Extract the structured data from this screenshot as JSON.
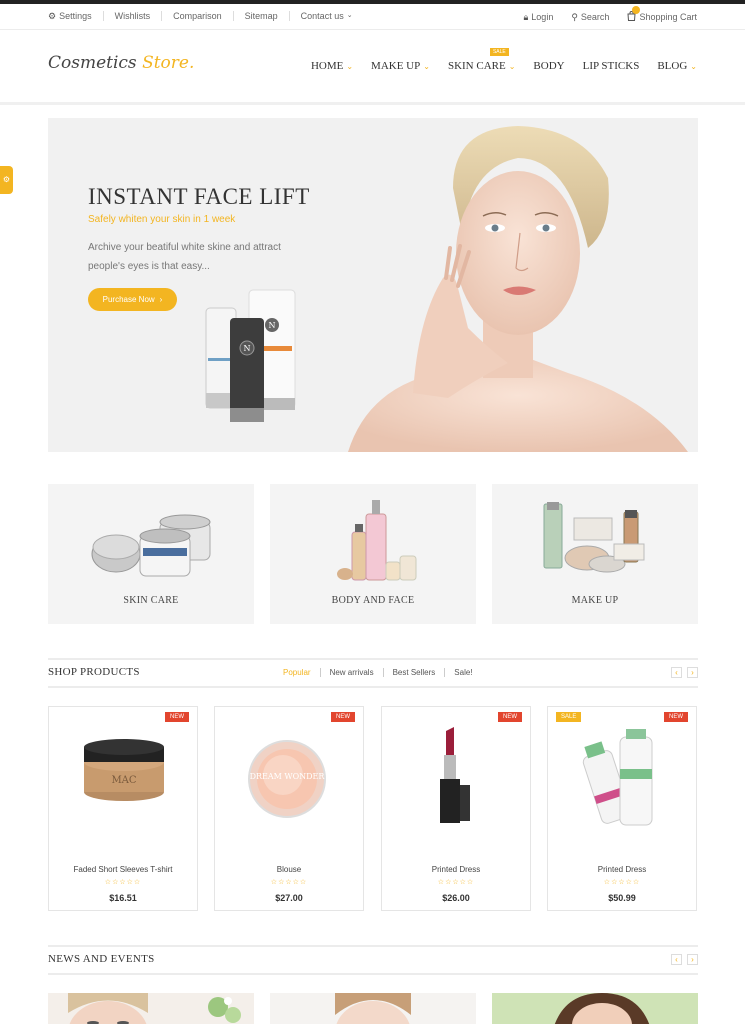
{
  "topbar": {
    "left": [
      "Settings",
      "Wishlists",
      "Comparison",
      "Sitemap",
      "Contact us"
    ],
    "login": "Login",
    "search": "Search",
    "cart": "Shopping Cart"
  },
  "logo": {
    "part1": "Cosmetics",
    "part2": "Store."
  },
  "nav": {
    "items": [
      "HOME",
      "MAKE UP",
      "SKIN CARE",
      "BODY",
      "LIP STICKS",
      "BLOG"
    ],
    "sale_badge": "SALE"
  },
  "hero": {
    "title": "INSTANT FACE LIFT",
    "subtitle": "Safely whiten your skin in 1 week",
    "description": "Archive your beatiful white skine and attract people's eyes is that easy...",
    "button": "Purchase Now"
  },
  "categories": [
    "SKIN CARE",
    "BODY AND FACE",
    "MAKE UP"
  ],
  "shop": {
    "title": "SHOP PRODUCTS",
    "tabs": [
      "Popular",
      "New arrivals",
      "Best Sellers",
      "Sale!"
    ],
    "products": [
      {
        "name": "Faded Short Sleeves T-shirt",
        "price": "$16.51",
        "badge": "NEW",
        "stars": "☆☆☆☆☆"
      },
      {
        "name": "Blouse",
        "price": "$27.00",
        "badge": "NEW",
        "stars": "☆☆☆☆☆"
      },
      {
        "name": "Printed Dress",
        "price": "$26.00",
        "badge": "NEW",
        "stars": "☆☆☆☆☆"
      },
      {
        "name": "Printed Dress",
        "price": "$50.99",
        "badge": "NEW",
        "sale": "SALE",
        "stars": "☆☆☆☆☆"
      }
    ],
    "product_labels": [
      "MAC",
      "DREAM WONDER"
    ]
  },
  "news": {
    "title": "NEWS AND EVENTS"
  },
  "colors": {
    "accent": "#f3b521",
    "new_badge": "#e2452e"
  }
}
